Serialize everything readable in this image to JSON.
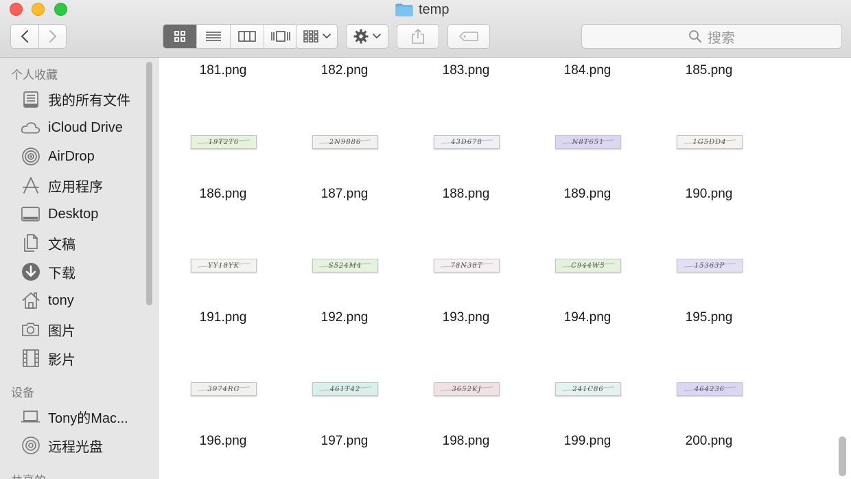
{
  "window": {
    "title": "temp"
  },
  "toolbar": {
    "search_placeholder": "搜索",
    "icons": {
      "back": "chevron-left-icon",
      "forward": "chevron-right-icon",
      "views": [
        "icon-view-icon",
        "list-view-icon",
        "column-view-icon",
        "cover-flow-icon"
      ],
      "arrange": "arrange-grid-icon",
      "action": "gear-icon",
      "share": "share-icon",
      "tag": "tag-icon",
      "search": "search-icon"
    },
    "active_view_index": 0
  },
  "sidebar": {
    "favorites_title": "个人收藏",
    "favorites": [
      {
        "label": "我的所有文件",
        "icon": "all-files-icon"
      },
      {
        "label": "iCloud Drive",
        "icon": "cloud-icon"
      },
      {
        "label": "AirDrop",
        "icon": "airdrop-icon"
      },
      {
        "label": "应用程序",
        "icon": "applications-icon"
      },
      {
        "label": "Desktop",
        "icon": "desktop-icon"
      },
      {
        "label": "文稿",
        "icon": "documents-icon"
      },
      {
        "label": "下载",
        "icon": "download-icon"
      },
      {
        "label": "tony",
        "icon": "home-icon"
      },
      {
        "label": "图片",
        "icon": "camera-icon"
      },
      {
        "label": "影片",
        "icon": "film-icon"
      }
    ],
    "devices_title": "设备",
    "devices": [
      {
        "label": "Tony的Mac...",
        "icon": "laptop-icon"
      },
      {
        "label": "远程光盘",
        "icon": "disc-icon"
      }
    ],
    "shared_title": "共享的"
  },
  "files": {
    "rows": [
      {
        "names": [
          "181.png",
          "182.png",
          "183.png",
          "184.png",
          "185.png"
        ]
      },
      {
        "thumbs": [
          "19T2T6",
          "2N9886",
          "43D678",
          "N8T651",
          "1G5DD4"
        ],
        "names": [
          "186.png",
          "187.png",
          "188.png",
          "189.png",
          "190.png"
        ]
      },
      {
        "thumbs": [
          "YY18YK",
          "S524M4",
          "78N38T",
          "C944W5",
          "15363P"
        ],
        "names": [
          "191.png",
          "192.png",
          "193.png",
          "194.png",
          "195.png"
        ]
      },
      {
        "thumbs": [
          "3974RG",
          "461T42",
          "3652KJ",
          "241C86",
          "464236"
        ],
        "names": [
          "196.png",
          "197.png",
          "198.png",
          "199.png",
          "200.png"
        ]
      }
    ],
    "thumb_colors": [
      [
        "#e7f2dc",
        "#f1f1ef",
        "#eef0f5",
        "#ddd6f2",
        "#f5f3ef"
      ],
      [
        "#f5f3ef",
        "#e5f2dc",
        "#f5f0ef",
        "#e4f2dc",
        "#e5dff4"
      ],
      [
        "#f1f1ef",
        "#d9efec",
        "#f2e1e2",
        "#e4f2f0",
        "#dad6f4"
      ]
    ]
  }
}
